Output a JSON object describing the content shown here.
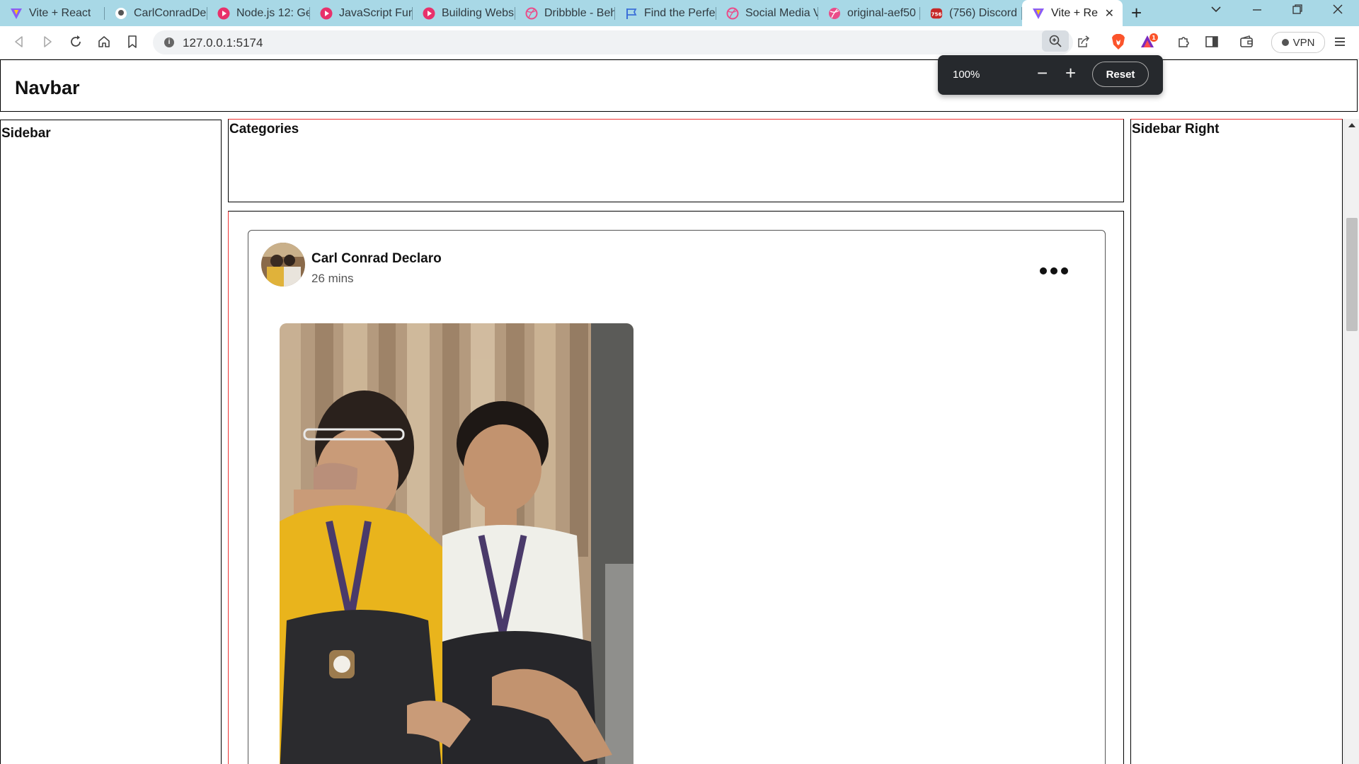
{
  "browser": {
    "tabs": [
      {
        "label": "Vite + React",
        "icon": "vite-icon"
      },
      {
        "label": "CarlConradDec",
        "icon": "github-icon"
      },
      {
        "label": "Node.js 12: Ge",
        "icon": "play-icon"
      },
      {
        "label": "JavaScript Fun",
        "icon": "play-icon"
      },
      {
        "label": "Building Webs",
        "icon": "play-icon"
      },
      {
        "label": "Dribbble - Beh",
        "icon": "dribbble-icon"
      },
      {
        "label": "Find the Perfec",
        "icon": "flag-icon"
      },
      {
        "label": "Social Media V",
        "icon": "dribbble-icon"
      },
      {
        "label": "original-aef50",
        "icon": "dribbble-icon"
      },
      {
        "label": "(756) Discord",
        "icon": "discord-icon",
        "badge": "756"
      },
      {
        "label": "Vite + Re",
        "icon": "vite-icon",
        "active": true
      }
    ],
    "url": "127.0.0.1:5174",
    "vpn_label": "VPN",
    "notification_count": "1",
    "zoom": {
      "level": "100%",
      "minus": "−",
      "plus": "+",
      "reset_label": "Reset"
    }
  },
  "page": {
    "navbar_title": "Navbar",
    "sidebar_title": "Sidebar",
    "categories_title": "Categories",
    "sidebar_right_title": "Sidebar Right",
    "post": {
      "author": "Carl Conrad Declaro",
      "time": "26 mins"
    }
  },
  "colors": {
    "tab_strip": "#a8d8e6",
    "accent_red_border": "#e33",
    "brave_orange": "#fb542b"
  }
}
